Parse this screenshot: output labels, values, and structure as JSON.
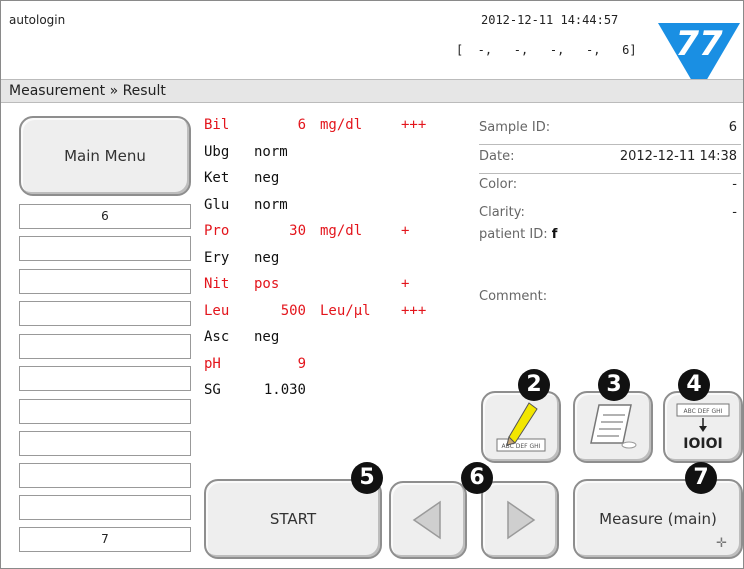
{
  "header": {
    "user": "autologin",
    "datetime": "2012-12-11  14:44:57",
    "slots": "[  -,   -,   -,   -,   6]",
    "breadcrumb": "Measurement » Result"
  },
  "sidebar": {
    "main_menu_label": "Main Menu",
    "slots": [
      "6",
      "",
      "",
      "",
      "",
      "",
      "",
      "",
      "",
      "",
      "",
      "7"
    ]
  },
  "results": [
    {
      "param": "Bil",
      "value": "6",
      "unit": "mg/dl",
      "flag": "+++",
      "abnormal": true
    },
    {
      "param": "Ubg",
      "value": "norm",
      "unit": "",
      "flag": "",
      "abnormal": false
    },
    {
      "param": "Ket",
      "value": "neg",
      "unit": "",
      "flag": "",
      "abnormal": false
    },
    {
      "param": "Glu",
      "value": "norm",
      "unit": "",
      "flag": "",
      "abnormal": false
    },
    {
      "param": "Pro",
      "value": "30",
      "unit": "mg/dl",
      "flag": "+",
      "abnormal": true
    },
    {
      "param": "Ery",
      "value": "neg",
      "unit": "",
      "flag": "",
      "abnormal": false
    },
    {
      "param": "Nit",
      "value": "pos",
      "unit": "",
      "flag": "+",
      "abnormal": true
    },
    {
      "param": "Leu",
      "value": "500",
      "unit": "Leu/µl",
      "flag": "+++",
      "abnormal": true
    },
    {
      "param": "Asc",
      "value": "neg",
      "unit": "",
      "flag": "",
      "abnormal": false
    },
    {
      "param": "pH",
      "value": "9",
      "unit": "",
      "flag": "",
      "abnormal": true
    },
    {
      "param": "SG",
      "value": "1.030",
      "unit": "",
      "flag": "",
      "abnormal": false
    }
  ],
  "info": {
    "sample_id_label": "Sample ID:",
    "sample_id_value": "6",
    "date_label": "Date:",
    "date_value": "2012-12-11 14:38",
    "color_label": "Color:",
    "color_value": "-",
    "clarity_label": "Clarity:",
    "clarity_value": "-",
    "patient_label": "patient ID:",
    "patient_value": "f",
    "comment_label": "Comment:"
  },
  "buttons": {
    "start_label": "START",
    "measure_label": "Measure (main)",
    "edit_icon_text": "ABC DEF GHI",
    "barcode_top_text": "ABC DEF GHI",
    "barcode_bottom_text": "IOIOI"
  },
  "badges": [
    "2",
    "3",
    "4",
    "5",
    "6",
    "7"
  ],
  "colors": {
    "abnormal": "#e3151c",
    "logo": "#1a8fe3"
  },
  "icons": {
    "logo": "77-logo-icon",
    "edit": "pencil-edit-icon",
    "print": "printer-icon",
    "barcode": "barcode-icon",
    "prev": "arrow-left-icon",
    "next": "arrow-right-icon",
    "crosshair": "crosshair-icon"
  }
}
